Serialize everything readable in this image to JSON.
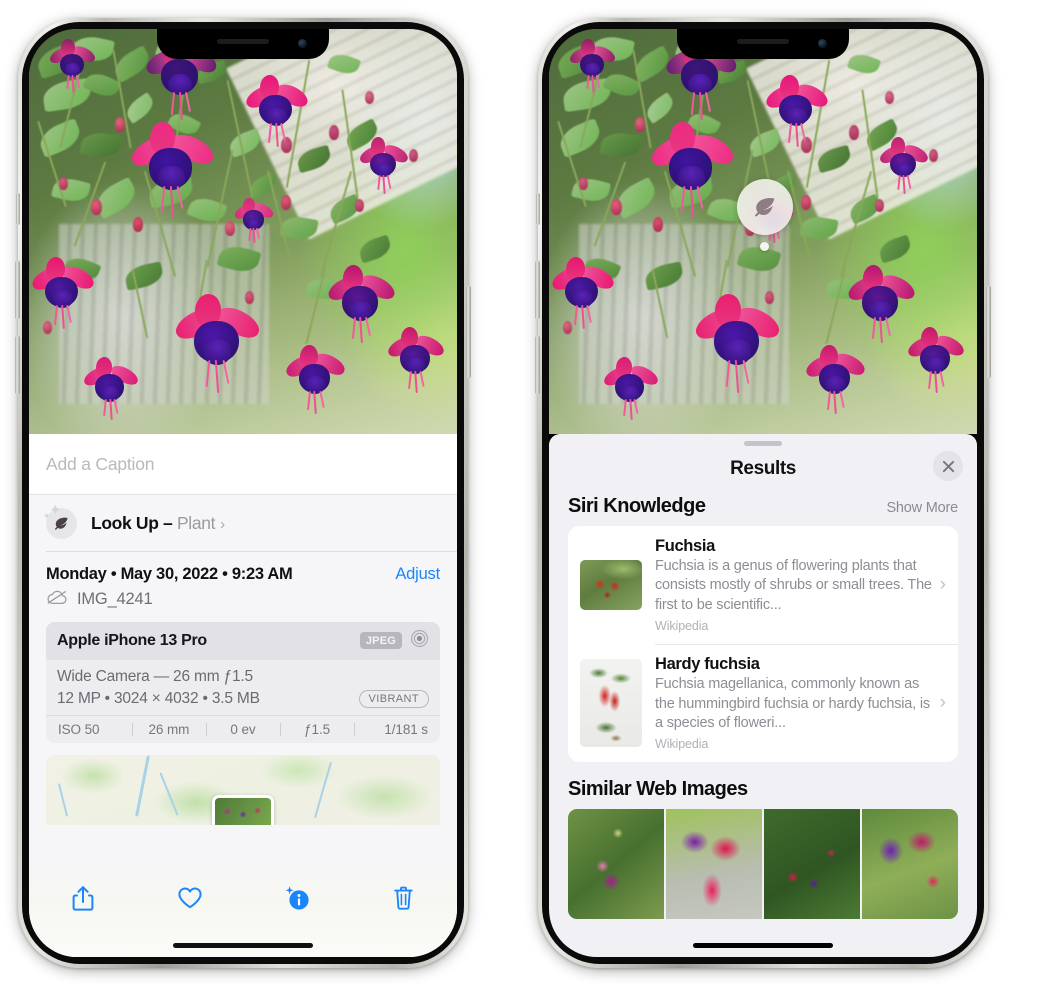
{
  "left_phone": {
    "caption_placeholder": "Add a Caption",
    "lookup": {
      "label": "Look Up",
      "dash": " – ",
      "subject": "Plant",
      "chevron": "›",
      "icon": "leaf-icon"
    },
    "date": "Monday • May 30, 2022 • 9:23 AM",
    "adjust_label": "Adjust",
    "filename": "IMG_4241",
    "exif": {
      "model": "Apple iPhone 13 Pro",
      "format_badge": "JPEG",
      "lens_line": "Wide Camera — 26 mm ƒ1.5",
      "size_line": "12 MP • 3024 × 4032 • 3.5 MB",
      "style_badge": "VIBRANT",
      "values": [
        "ISO 50",
        "26 mm",
        "0 ev",
        "ƒ1.5",
        "1/181 s"
      ]
    },
    "toolbar": {
      "share": "share-icon",
      "favorite": "heart-icon",
      "info": "info-sparkle-icon",
      "delete": "trash-icon"
    }
  },
  "right_phone": {
    "badge_icon": "leaf-icon",
    "sheet_title": "Results",
    "close_label": "✕",
    "siri": {
      "section_title": "Siri Knowledge",
      "show_more": "Show More",
      "cards": [
        {
          "title": "Fuchsia",
          "desc": "Fuchsia is a genus of flowering plants that consists mostly of shrubs or small trees. The first to be scientific...",
          "source": "Wikipedia",
          "chevron": "›"
        },
        {
          "title": "Hardy fuchsia",
          "desc": "Fuchsia magellanica, commonly known as the hummingbird fuchsia or hardy fuchsia, is a species of floweri...",
          "source": "Wikipedia",
          "chevron": "›"
        }
      ]
    },
    "similar": {
      "section_title": "Similar Web Images",
      "count": 4
    }
  },
  "colors": {
    "accent_blue": "#1b86fc",
    "sheet_bg": "#f1f1f5",
    "panel_bg": "#f6f6f8",
    "muted_text": "#8d8d95"
  }
}
